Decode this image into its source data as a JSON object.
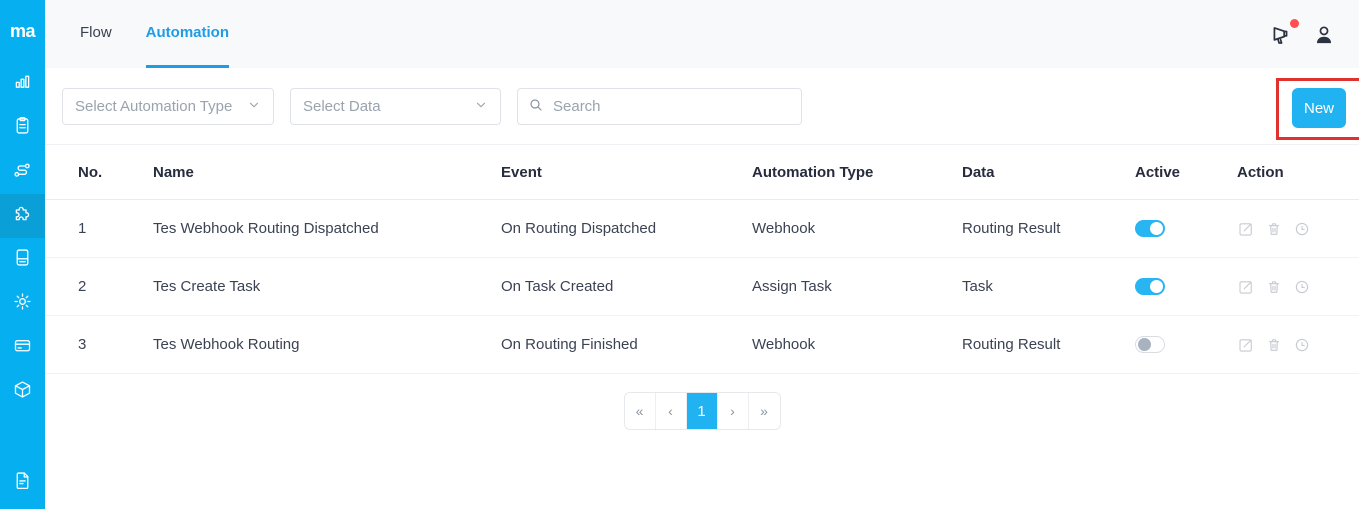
{
  "sidebar": {
    "logo": "ma",
    "items": [
      {
        "icon": "bar-chart-icon",
        "active": false
      },
      {
        "icon": "clipboard-icon",
        "active": false
      },
      {
        "icon": "route-icon",
        "active": false
      },
      {
        "icon": "puzzle-icon",
        "active": true
      },
      {
        "icon": "document-icon",
        "active": false
      },
      {
        "icon": "settings-gear-icon",
        "active": false
      },
      {
        "icon": "credit-card-icon",
        "active": false
      },
      {
        "icon": "package-icon",
        "active": false
      }
    ],
    "bottom_item": {
      "icon": "document-lines-icon"
    }
  },
  "header": {
    "tabs": [
      {
        "label": "Flow",
        "active": false
      },
      {
        "label": "Automation",
        "active": true
      }
    ],
    "icons": [
      "megaphone-icon",
      "user-icon"
    ],
    "notification_dot": true
  },
  "toolbar": {
    "automation_type_placeholder": "Select Automation Type",
    "data_placeholder": "Select Data",
    "search_placeholder": "Search",
    "new_button_label": "New"
  },
  "table": {
    "columns": [
      "No.",
      "Name",
      "Event",
      "Automation Type",
      "Data",
      "Active",
      "Action"
    ],
    "rows": [
      {
        "no": "1",
        "name": "Tes Webhook Routing Dispatched",
        "event": "On Routing Dispatched",
        "automation_type": "Webhook",
        "data": "Routing Result",
        "active": true
      },
      {
        "no": "2",
        "name": "Tes Create Task",
        "event": "On Task Created",
        "automation_type": "Assign Task",
        "data": "Task",
        "active": true
      },
      {
        "no": "3",
        "name": "Tes Webhook Routing",
        "event": "On Routing Finished",
        "automation_type": "Webhook",
        "data": "Routing Result",
        "active": false
      }
    ],
    "row_actions": [
      "edit-icon",
      "delete-icon",
      "history-clock-icon"
    ]
  },
  "pagination": {
    "first_label": "«",
    "prev_label": "‹",
    "page_label": "1",
    "current_page": "1",
    "next_label": "›",
    "last_label": "»"
  },
  "colors": {
    "sidebar": "#05aff0",
    "sidebar_active": "#0a9fd6",
    "accent_blue": "#20b2f1",
    "tab_blue": "#1e9ce8",
    "toggle_on": "#29b5f2",
    "annotation_red": "#e0312e",
    "notification_dot": "#ff4f4f"
  }
}
